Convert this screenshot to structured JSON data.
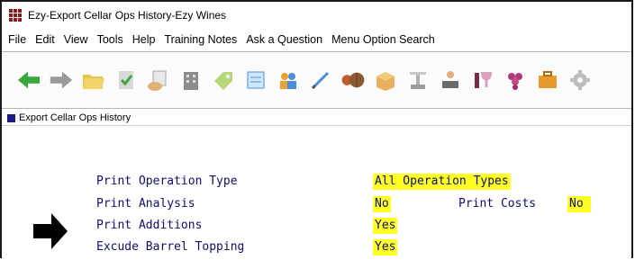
{
  "window": {
    "title": "Ezy-Export Cellar Ops History-Ezy Wines",
    "icon": "grid-app-icon"
  },
  "menu": {
    "items": [
      "File",
      "Edit",
      "View",
      "Tools",
      "Help",
      "Training Notes",
      "Ask a Question",
      "Menu Option Search"
    ]
  },
  "toolbar": {
    "buttons": [
      "green-left-arrow-icon",
      "grey-right-arrow-icon",
      "folder-open-icon",
      "document-check-icon",
      "hand-document-icon",
      "building-icon",
      "tag-icon",
      "document-icon",
      "people-icon",
      "pen-icon",
      "barrel-icon",
      "box-icon",
      "scale-icon",
      "person-laptop-icon",
      "wine-glass-icon",
      "grapes-icon",
      "briefcase-icon",
      "gear-icon"
    ]
  },
  "panel": {
    "title": "Export Cellar Ops History"
  },
  "form": {
    "print_operation_type_label": "Print Operation Type",
    "print_operation_type_value": "All Operation Types",
    "print_analysis_label": "Print Analysis",
    "print_analysis_value": "No",
    "print_costs_label": "Print Costs",
    "print_costs_value": "No",
    "print_additions_label": "Print Additions",
    "print_additions_value": "Yes",
    "exclude_barrel_topping_label": "Excude Barrel Topping",
    "exclude_barrel_topping_value": "Yes"
  },
  "colors": {
    "field_text": "#0e0e6e",
    "value_highlight": "#ffff24",
    "panel_icon": "#1a1a80",
    "app_icon": "#8b1a1a"
  }
}
